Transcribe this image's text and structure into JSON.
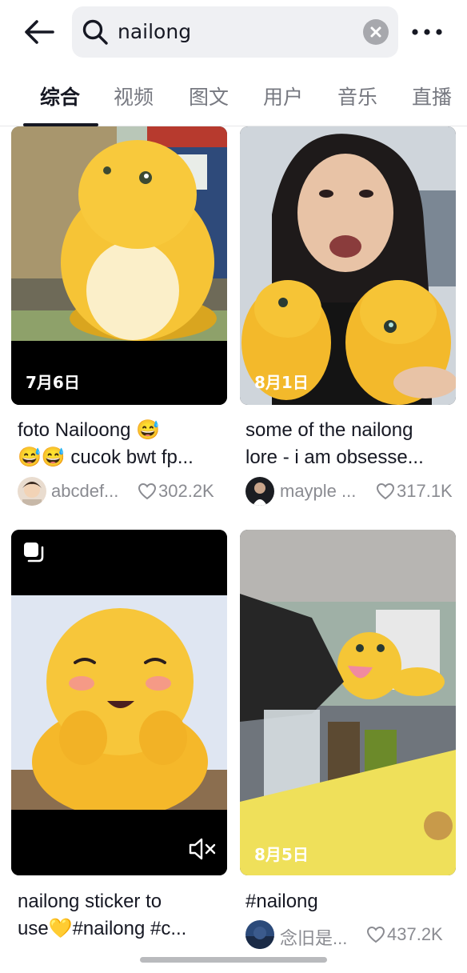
{
  "search": {
    "query": "nailong"
  },
  "tabs": [
    {
      "label": "综合",
      "active": true
    },
    {
      "label": "视频",
      "active": false
    },
    {
      "label": "图文",
      "active": false
    },
    {
      "label": "用户",
      "active": false
    },
    {
      "label": "音乐",
      "active": false
    },
    {
      "label": "直播",
      "active": false
    }
  ],
  "cards": [
    {
      "date": "7月6日",
      "title": "foto Nailoong 😅\n😅😅 cucok bwt fp...",
      "author": "abcdef...",
      "likes": "302.2K"
    },
    {
      "date": "8月1日",
      "title": "some of the nailong\nlore - i am obsesse...",
      "author": "mayple ...",
      "likes": "317.1K"
    },
    {
      "date": "",
      "title": "nailong sticker to\nuse💛#nailong #c...",
      "author": "",
      "likes": "",
      "muted": true,
      "multi_image": true
    },
    {
      "date": "8月5日",
      "title": "#nailong",
      "author": "念旧是...",
      "likes": "437.2K"
    }
  ],
  "colors": {
    "nailong_yellow": "#f6c436",
    "text": "#161823",
    "muted": "#8a8b91"
  }
}
